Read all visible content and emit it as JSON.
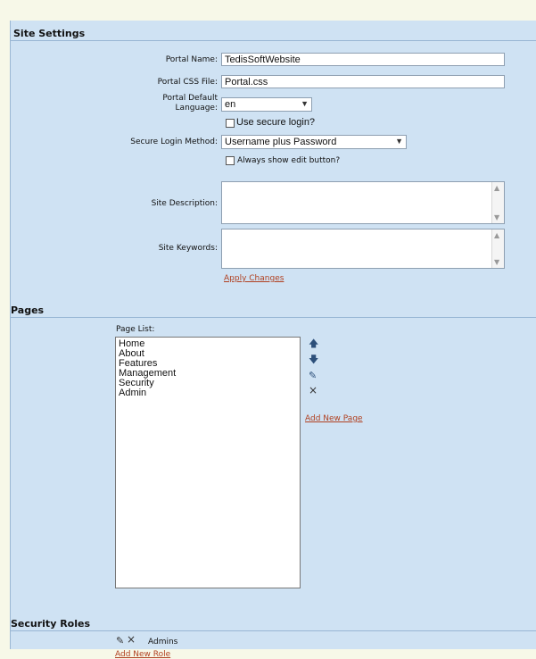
{
  "site_settings": {
    "title": "Site Settings",
    "portal_name_label": "Portal Name:",
    "portal_name_value": "TedisSoftWebsite",
    "portal_css_label": "Portal CSS File:",
    "portal_css_value": "Portal.css",
    "default_language_label_1": "Portal Default",
    "default_language_label_2": "Language:",
    "default_language_value": "en",
    "use_secure_login_label": "Use secure login?",
    "secure_login_method_label": "Secure Login Method:",
    "secure_login_method_value": "Username plus Password",
    "always_show_edit_label": "Always show edit button?",
    "site_description_label": "Site Description:",
    "site_keywords_label": "Site Keywords:",
    "apply_changes": "Apply Changes"
  },
  "pages": {
    "title": "Pages",
    "page_list_label": "Page List:",
    "items": [
      "Home",
      "About",
      "Features",
      "Management",
      "Security",
      "Admin"
    ],
    "add_new_page": "Add New Page"
  },
  "security_roles": {
    "title": "Security Roles",
    "role_name": "Admins",
    "add_new_role": "Add New Role"
  }
}
